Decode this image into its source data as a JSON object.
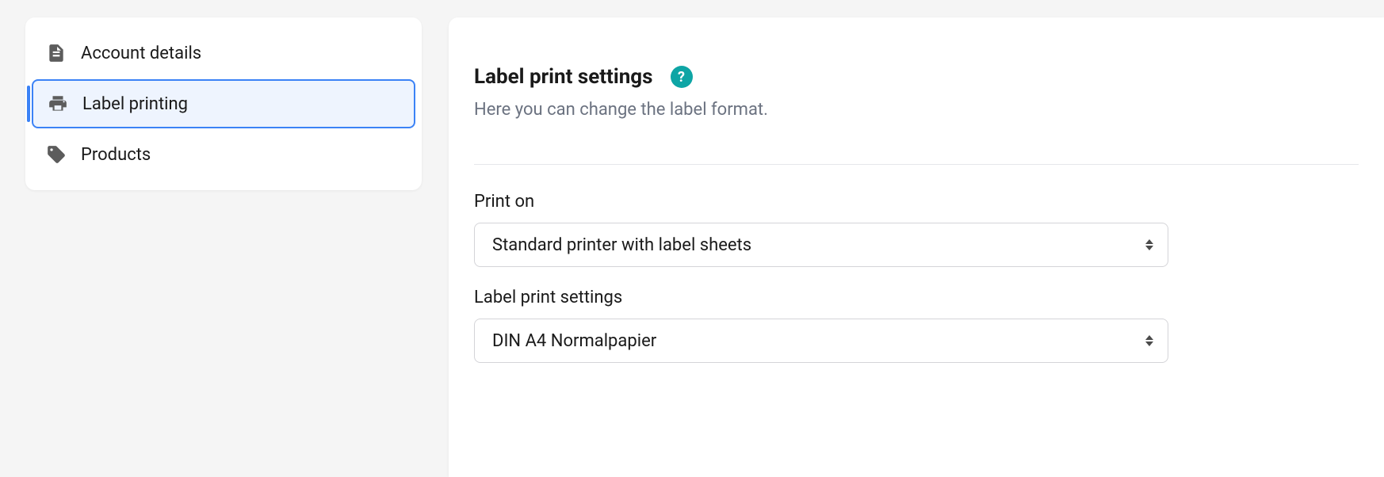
{
  "sidebar": {
    "items": [
      {
        "label": "Account details",
        "icon": "document-icon"
      },
      {
        "label": "Label printing",
        "icon": "printer-icon"
      },
      {
        "label": "Products",
        "icon": "tag-icon"
      }
    ],
    "active_index": 1
  },
  "main": {
    "title": "Label print settings",
    "description": "Here you can change the label format.",
    "fields": [
      {
        "label": "Print on",
        "value": "Standard printer with label sheets"
      },
      {
        "label": "Label print settings",
        "value": "DIN A4 Normalpapier"
      }
    ]
  }
}
